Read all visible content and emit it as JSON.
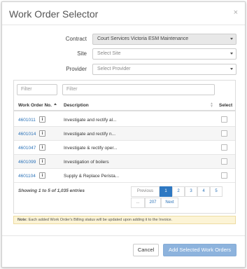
{
  "modal": {
    "title": "Work Order Selector",
    "close_label": "×"
  },
  "form": {
    "contract_label": "Contract",
    "contract_value": "Court Services Victoria ESM Maintenance",
    "site_label": "Site",
    "site_placeholder": "Select Site",
    "provider_label": "Provider",
    "provider_placeholder": "Select Provider"
  },
  "filters": {
    "filter1_placeholder": "Filter",
    "filter2_placeholder": "Filter"
  },
  "table": {
    "headers": [
      "Work Order No.",
      "Description",
      "Select"
    ],
    "rows": [
      {
        "wo": "4601011",
        "desc": "Investigate and rectify al..."
      },
      {
        "wo": "4601014",
        "desc": "Investigate and rectify n..."
      },
      {
        "wo": "4601047",
        "desc": "Investigate & rectify oper..."
      },
      {
        "wo": "4601099",
        "desc": "Investigation of boilers"
      },
      {
        "wo": "4601104",
        "desc": "Supply & Replace Perista..."
      }
    ],
    "info_glyph": "i"
  },
  "pagination": {
    "showing": "Showing 1 to 5 of 1,035 entries",
    "previous": "Previous",
    "pages": [
      "1",
      "2",
      "3",
      "4",
      "5"
    ],
    "ellipsis": "...",
    "last": "207",
    "next": "Next"
  },
  "note": {
    "bold": "Note:",
    "text": " Each added Work Order's Billing status will be updated upon adding it to the Invoice."
  },
  "footer": {
    "cancel": "Cancel",
    "add": "Add Selected Work Orders"
  },
  "colors": {
    "accent": "#2e78c2",
    "link": "#2b72b8",
    "add_button": "#8db3dd",
    "note_bg": "#fcf4d6"
  }
}
